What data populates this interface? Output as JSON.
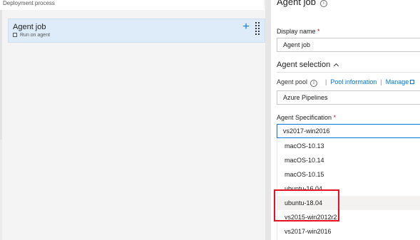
{
  "left": {
    "breadcrumb": "Deployment process",
    "agent_card": {
      "title": "Agent job",
      "subtitle": "Run on agent",
      "add_symbol": "+"
    }
  },
  "right": {
    "heading": "Agent job",
    "info_glyph": "i",
    "display_name": {
      "label": "Display name",
      "required": "*",
      "value": "Agent job"
    },
    "agent_selection": {
      "title": "Agent selection"
    },
    "agent_pool": {
      "label": "Agent pool",
      "separator": "|",
      "pool_info_link": "Pool information",
      "manage_link": "Manage",
      "value": "Azure Pipelines"
    },
    "agent_spec": {
      "label": "Agent Specification",
      "required": "*",
      "value": "vs2017-win2016",
      "options": [
        "macOS-10.13",
        "macOS-10.14",
        "macOS-10.15",
        "ubuntu-16.04",
        "ubuntu-18.04",
        "vs2015-win2012r2",
        "vs2017-win2016"
      ],
      "hovered_option": "ubuntu-18.04"
    }
  },
  "colors": {
    "accent": "#0078d4",
    "selected_card": "#deecf9",
    "annotation_red": "#e81123"
  }
}
